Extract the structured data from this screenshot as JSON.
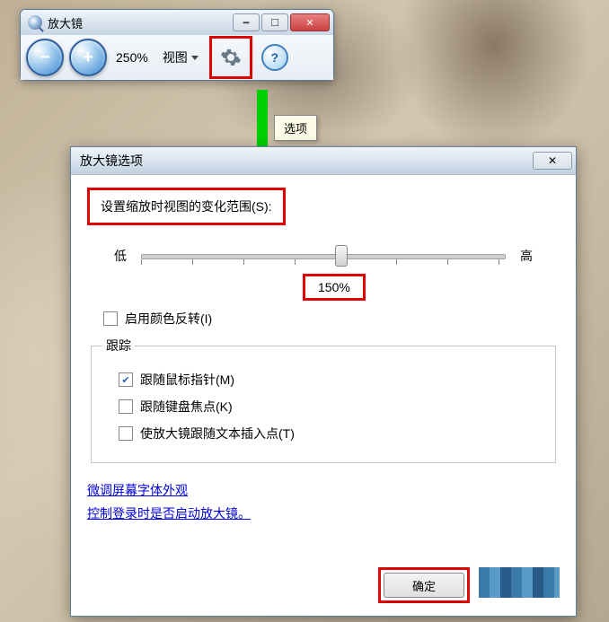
{
  "magnifier": {
    "title": "放大镜",
    "zoom_minus": "−",
    "zoom_plus": "+",
    "zoom_level": "250%",
    "view_label": "视图",
    "help": "?",
    "tooltip": "选项"
  },
  "options": {
    "title": "放大镜选项",
    "scale_label": "设置缩放时视图的变化范围(S):",
    "low": "低",
    "high": "高",
    "scale_value": "150%",
    "invert_colors": "启用颜色反转(I)",
    "tracking_legend": "跟踪",
    "follow_mouse": "跟随鼠标指针(M)",
    "follow_keyboard": "跟随键盘焦点(K)",
    "follow_text": "使放大镜跟随文本插入点(T)",
    "link_font": "微调屏幕字体外观",
    "link_startup": "控制登录时是否启动放大镜。",
    "ok": "确定"
  }
}
